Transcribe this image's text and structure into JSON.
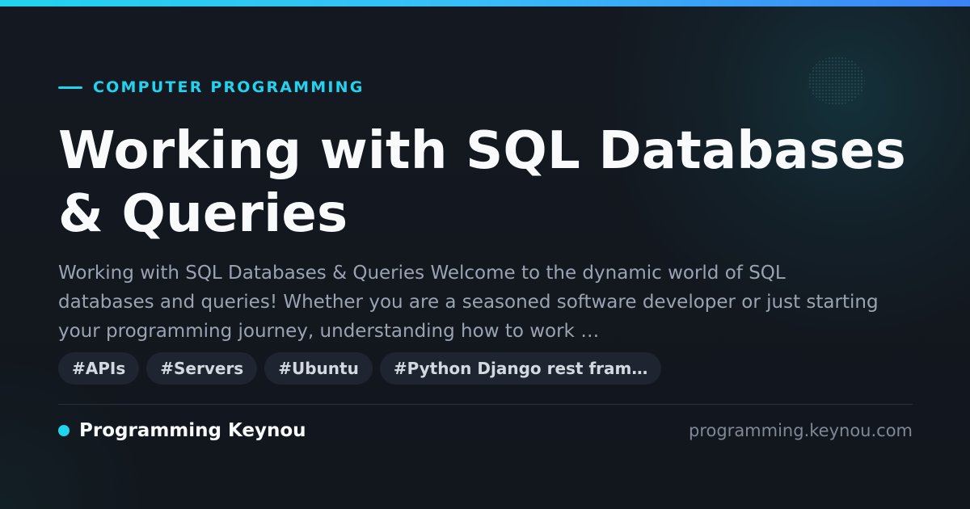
{
  "category": "COMPUTER PROGRAMMING",
  "title": "Working with SQL Databases & Queries",
  "description": "Working with SQL Databases & Queries Welcome to the dynamic world of SQL databases and queries! Whether you are a seasoned software developer or just starting your programming journey, understanding how to work …",
  "tags": [
    "#APIs",
    "#Servers",
    "#Ubuntu",
    "#Python Django rest fram…"
  ],
  "brand": {
    "name": "Programming Keynou"
  },
  "site_url": "programming.keynou.com",
  "colors": {
    "accent": "#22d3ee",
    "background": "#13171f",
    "title": "#f8fafc",
    "description": "#9aa3b2",
    "tag_background": "#1f2530",
    "site_text": "#7f8896"
  }
}
